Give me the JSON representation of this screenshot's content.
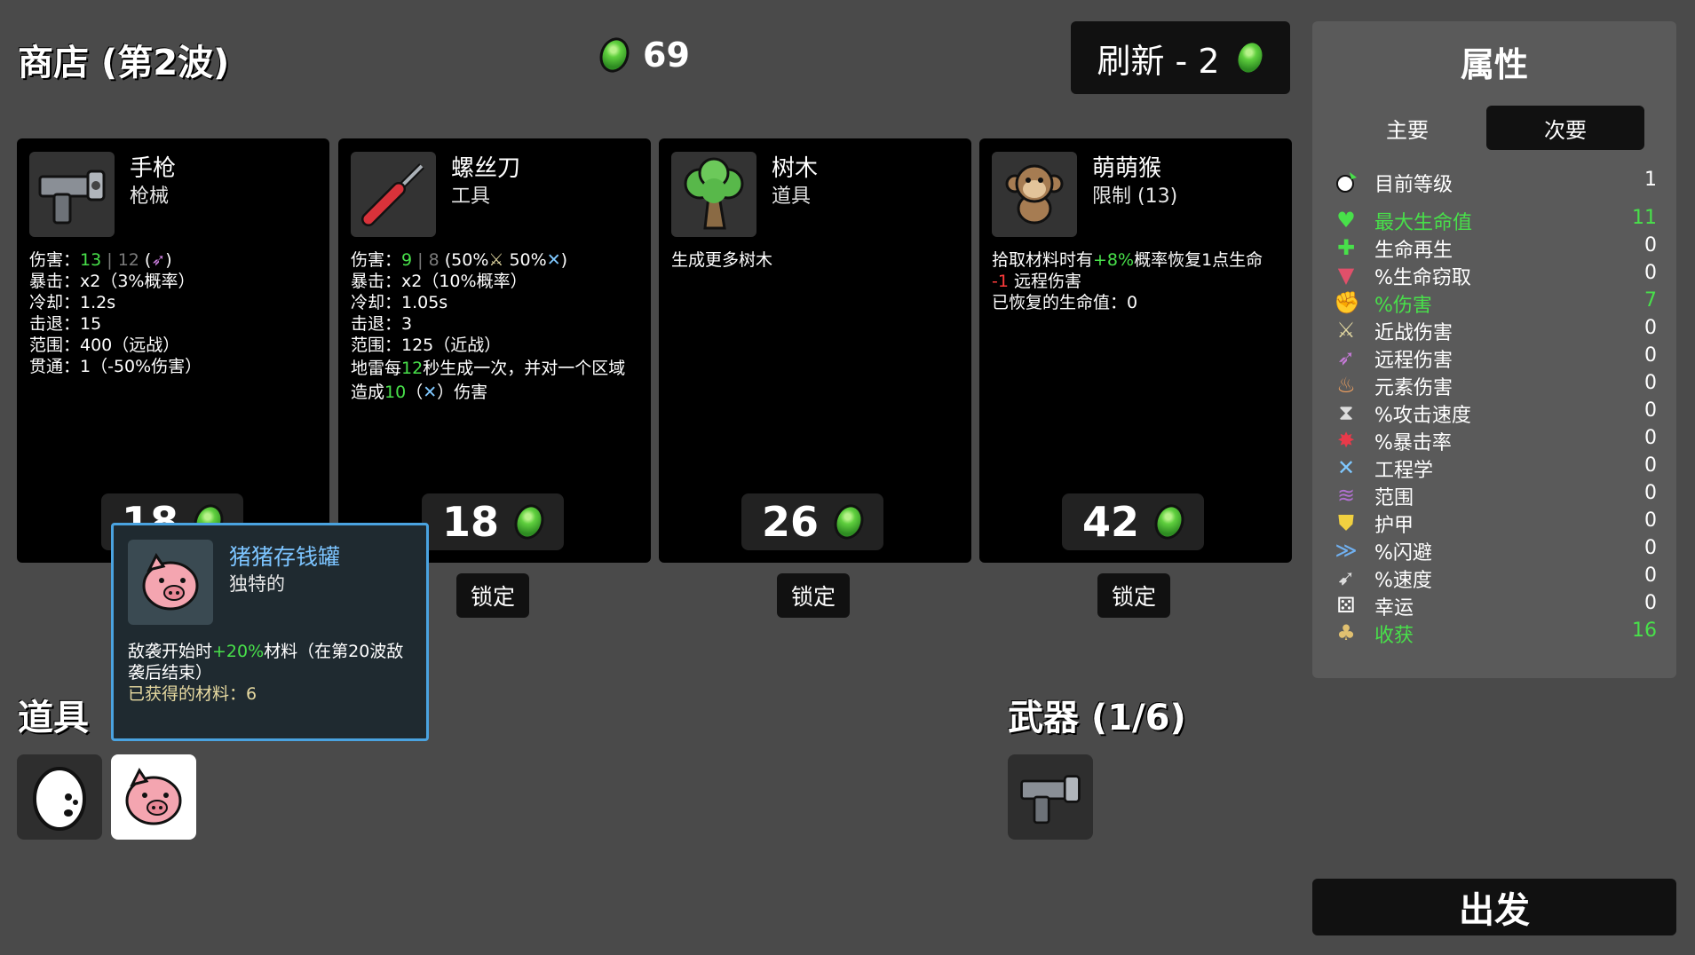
{
  "header": {
    "title": "商店 (第2波)",
    "materials": "69",
    "reroll_label": "刷新 - 2"
  },
  "shop_items": [
    {
      "name": "手枪",
      "type": "枪械",
      "price": "18",
      "icon": "pistol-icon"
    },
    {
      "name": "螺丝刀",
      "type": "工具",
      "price": "18",
      "icon": "screwdriver-icon",
      "lock_label": "锁定"
    },
    {
      "name": "树木",
      "type": "道具",
      "price": "26",
      "icon": "tree-icon",
      "desc": "生成更多树木",
      "lock_label": "锁定"
    },
    {
      "name": "萌萌猴",
      "type": "限制 (13)",
      "price": "42",
      "icon": "monkey-icon",
      "lock_label": "锁定"
    }
  ],
  "pistol_stats": {
    "damage_label": "伤害：",
    "damage_value": "13",
    "damage_sep": " | ",
    "damage_base": "12",
    "damage_tail": ")",
    "crit": "暴击：x2（3%概率）",
    "cooldown": "冷却：1.2s",
    "knockback": "击退：15",
    "range": "范围：400（远战）",
    "pierce": "贯通：1（-50%伤害）"
  },
  "screwdriver_stats": {
    "damage_label": "伤害：",
    "damage_value": "9",
    "damage_sep": " | ",
    "damage_base": "8",
    "damage_scaling_a": " (50%",
    "damage_scaling_b": " 50%",
    "damage_tail": ")",
    "crit": "暴击：x2（10%概率）",
    "cooldown": "冷却：1.05s",
    "knockback": "击退：3",
    "range": "范围：125（近战）",
    "landmine_a": "地雷每",
    "landmine_interval": "12",
    "landmine_b": "秒生成一次，并对一个区域",
    "landmine_c": "造成",
    "landmine_damage": "10",
    "landmine_d": "（",
    "landmine_e": "）伤害"
  },
  "monkey_desc": {
    "line1_a": "拾取材料时有",
    "line1_chance": "+8%",
    "line1_b": "概率恢复1点生命",
    "line2_value": "-1",
    "line2_label": " 远程伤害",
    "line3": "已恢复的生命值：0"
  },
  "tooltip": {
    "name": "猪猪存钱罐",
    "rarity": "独特的",
    "desc_a": "敌袭开始时",
    "desc_pct": "+20%",
    "desc_b": "材料（在第20波敌袭后结束）",
    "gained": "已获得的材料：6"
  },
  "items_section": {
    "title": "道具"
  },
  "weapons_section": {
    "title": "武器 (1/6)"
  },
  "stats_panel": {
    "title": "属性",
    "tab_primary": "主要",
    "tab_secondary": "次要",
    "level_label": "目前等级",
    "level_value": "1",
    "stats": [
      {
        "label": "最大生命值",
        "value": "11",
        "color": "#48e04a",
        "icon": "heart-icon"
      },
      {
        "label": "生命再生",
        "value": "0",
        "color": "#ffffff",
        "icon": "regen-icon"
      },
      {
        "label": "%生命窃取",
        "value": "0",
        "color": "#ffffff",
        "icon": "lifesteal-icon"
      },
      {
        "label": "%伤害",
        "value": "7",
        "color": "#48e04a",
        "icon": "damage-icon"
      },
      {
        "label": "近战伤害",
        "value": "0",
        "color": "#ffffff",
        "icon": "melee-icon"
      },
      {
        "label": "远程伤害",
        "value": "0",
        "color": "#ffffff",
        "icon": "ranged-icon"
      },
      {
        "label": "元素伤害",
        "value": "0",
        "color": "#ffffff",
        "icon": "elemental-icon"
      },
      {
        "label": "%攻击速度",
        "value": "0",
        "color": "#ffffff",
        "icon": "attack-speed-icon"
      },
      {
        "label": "%暴击率",
        "value": "0",
        "color": "#ffffff",
        "icon": "crit-icon"
      },
      {
        "label": "工程学",
        "value": "0",
        "color": "#ffffff",
        "icon": "engineering-icon"
      },
      {
        "label": "范围",
        "value": "0",
        "color": "#ffffff",
        "icon": "range-icon"
      },
      {
        "label": "护甲",
        "value": "0",
        "color": "#ffffff",
        "icon": "armor-icon"
      },
      {
        "label": "%闪避",
        "value": "0",
        "color": "#ffffff",
        "icon": "dodge-icon"
      },
      {
        "label": "%速度",
        "value": "0",
        "color": "#ffffff",
        "icon": "speed-icon"
      },
      {
        "label": "幸运",
        "value": "0",
        "color": "#ffffff",
        "icon": "luck-icon"
      },
      {
        "label": "收获",
        "value": "16",
        "color": "#48e04a",
        "icon": "harvest-icon"
      }
    ]
  },
  "go_button": {
    "label": "出发"
  },
  "colors": {
    "green": "#48e04a",
    "red": "#ff3b3b",
    "tooltip_border": "#4aa3e0",
    "tooltip_title": "#7cc4ff"
  }
}
